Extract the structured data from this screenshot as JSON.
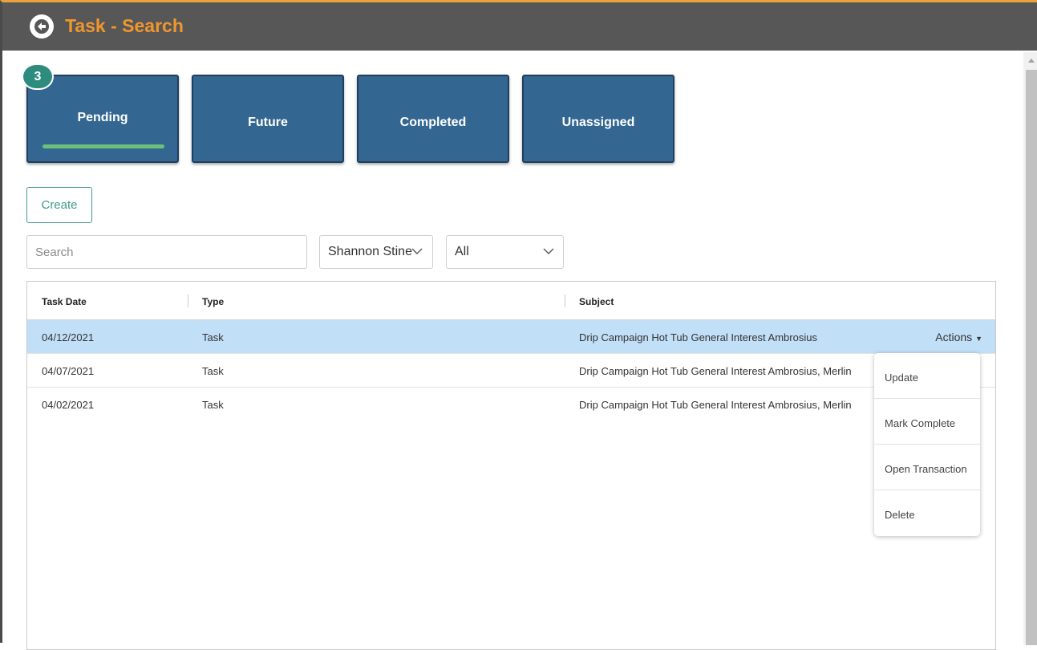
{
  "header": {
    "title": "Task - Search",
    "back_icon": "circle-arrow-left-icon",
    "background": "#575757",
    "title_color": "#f0962e"
  },
  "tabs": [
    {
      "label": "Pending",
      "active": true,
      "badge": "3"
    },
    {
      "label": "Future",
      "active": false
    },
    {
      "label": "Completed",
      "active": false
    },
    {
      "label": "Unassigned",
      "active": false
    }
  ],
  "toolbar": {
    "create_label": "Create",
    "search_placeholder": "Search",
    "search_value": "",
    "user_select": "Shannon Stine",
    "status_select": "All"
  },
  "table": {
    "columns": [
      "Task Date",
      "Type",
      "Subject"
    ],
    "rows": [
      {
        "date": "04/12/2021",
        "type": "Task",
        "subject": "Drip Campaign Hot Tub General Interest Ambrosius",
        "selected": true
      },
      {
        "date": "04/07/2021",
        "type": "Task",
        "subject": "Drip Campaign Hot Tub General Interest Ambrosius, Merlin",
        "selected": false
      },
      {
        "date": "04/02/2021",
        "type": "Task",
        "subject": "Drip Campaign Hot Tub General Interest Ambrosius, Merlin",
        "selected": false
      }
    ],
    "actions_label": "Actions"
  },
  "actions_menu": {
    "items": [
      "Update",
      "Mark Complete",
      "Open Transaction",
      "Delete"
    ]
  },
  "colors": {
    "tile": "#336792",
    "tile_active_bar": "#6cc17a",
    "badge": "#2e8c7e",
    "accent": "#3f9a8c",
    "selected_row": "#c2dff8"
  }
}
